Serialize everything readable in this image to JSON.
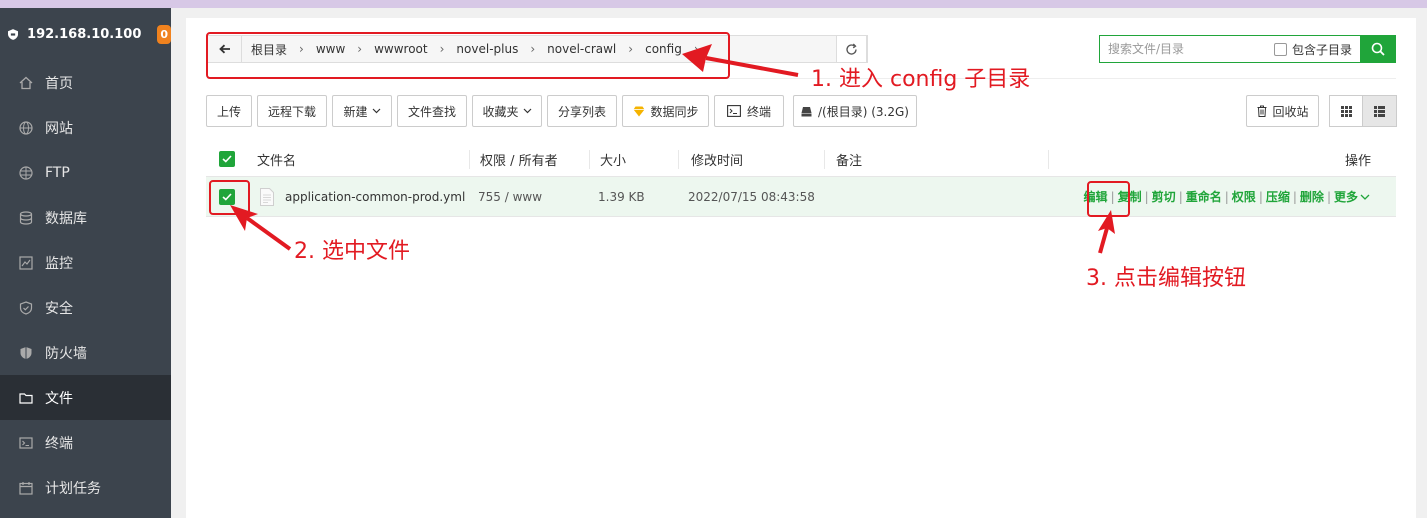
{
  "server": {
    "ip": "192.168.10.100",
    "badge": "0"
  },
  "sidebar": {
    "items": [
      {
        "label": "首页",
        "icon": "home-icon"
      },
      {
        "label": "网站",
        "icon": "globe-icon"
      },
      {
        "label": "FTP",
        "icon": "ftp-icon"
      },
      {
        "label": "数据库",
        "icon": "database-icon"
      },
      {
        "label": "监控",
        "icon": "monitor-icon"
      },
      {
        "label": "安全",
        "icon": "security-shield-icon"
      },
      {
        "label": "防火墙",
        "icon": "firewall-icon"
      },
      {
        "label": "文件",
        "icon": "folder-icon",
        "active": true
      },
      {
        "label": "终端",
        "icon": "terminal-icon"
      },
      {
        "label": "计划任务",
        "icon": "calendar-icon"
      }
    ]
  },
  "breadcrumb": [
    "根目录",
    "www",
    "wwwroot",
    "novel-plus",
    "novel-crawl",
    "config"
  ],
  "search": {
    "placeholder": "搜索文件/目录",
    "include_sub": "包含子目录"
  },
  "toolbar": {
    "upload": "上传",
    "remote_download": "远程下载",
    "new": "新建",
    "file_search": "文件查找",
    "favorites": "收藏夹",
    "share_list": "分享列表",
    "data_sync": "数据同步",
    "terminal": "终端",
    "disk": "/(根目录) (3.2G)",
    "recycle": "回收站"
  },
  "table": {
    "headers": {
      "name": "文件名",
      "perm": "权限 / 所有者",
      "size": "大小",
      "mtime": "修改时间",
      "remark": "备注",
      "ops": "操作"
    },
    "rows": [
      {
        "name": "application-common-prod.yml",
        "perm": "755 / www",
        "size": "1.39 KB",
        "mtime": "2022/07/15 08:43:58",
        "remark": ""
      }
    ],
    "ops": [
      "编辑",
      "复制",
      "剪切",
      "重命名",
      "权限",
      "压缩",
      "删除",
      "更多"
    ]
  },
  "annotations": {
    "step1": "1. 进入 config 子目录",
    "step2": "2. 选中文件",
    "step3": "3. 点击编辑按钮",
    "color": "#e21a22"
  },
  "colors": {
    "accent": "#20a53a",
    "sidebar_bg": "#3c444d",
    "badge": "#f0821e"
  }
}
